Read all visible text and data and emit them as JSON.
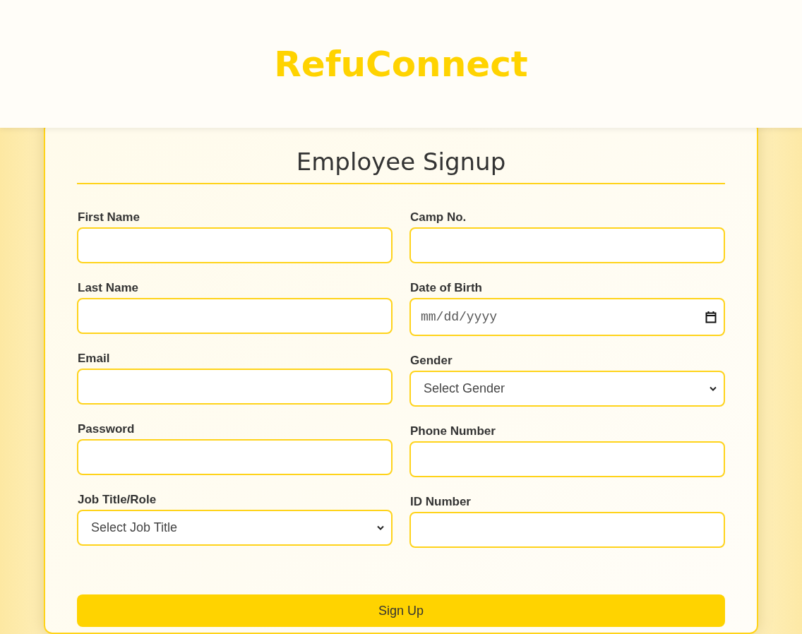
{
  "header": {
    "title": "RefuConnect"
  },
  "form": {
    "title": "Employee Signup",
    "columns": [
      [
        {
          "label": "First Name",
          "kind": "text"
        },
        {
          "label": "Last Name",
          "kind": "text"
        },
        {
          "label": "Email",
          "kind": "text"
        },
        {
          "label": "Password",
          "kind": "text"
        },
        {
          "label": "Job Title/Role",
          "kind": "select",
          "value": "Select Job Title"
        }
      ],
      [
        {
          "label": "Camp No.",
          "kind": "text"
        },
        {
          "label": "Date of Birth",
          "kind": "date",
          "placeholder": "mm/dd/yyyy"
        },
        {
          "label": "Gender",
          "kind": "select",
          "value": "Select Gender"
        },
        {
          "label": "Phone Number",
          "kind": "text"
        },
        {
          "label": "ID Number",
          "kind": "text"
        }
      ]
    ],
    "submit": "Sign Up"
  }
}
